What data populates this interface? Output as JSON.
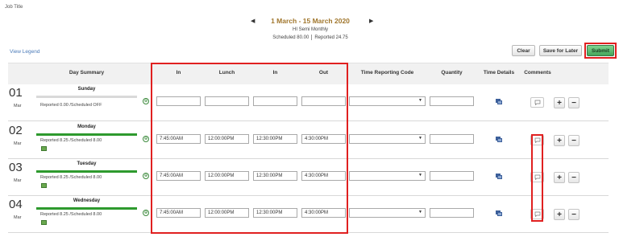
{
  "page": {
    "job_title": "Job Title"
  },
  "period": {
    "prev_arrow": "◀",
    "next_arrow": "▶",
    "range": "1 March - 15 March 2020",
    "type": "HI Semi Monthly",
    "scheduled": "Scheduled  80.00",
    "reported": "Reported  24.75"
  },
  "view_legend": "View Legend",
  "actions": {
    "clear": "Clear",
    "save_for_later": "Save for Later",
    "submit": "Submit"
  },
  "columns": {
    "day_summary": "Day Summary",
    "in": "In",
    "lunch": "Lunch",
    "in2": "In",
    "out": "Out",
    "time_reporting_code": "Time Reporting Code",
    "quantity": "Quantity",
    "time_details": "Time Details",
    "comments": "Comments"
  },
  "icons": {
    "expand": "⊕",
    "dropdown": "▼",
    "plus": "+",
    "minus": "−"
  },
  "colors": {
    "progress": "#2e9a2e",
    "highlight": "#e02020",
    "submit": "#46a45a"
  },
  "rows": [
    {
      "day": "01",
      "month": "Mar",
      "weekday": "Sunday",
      "reported_text": "Reported 0.00 /Scheduled OFF",
      "progress": 0,
      "in": "",
      "lunch": "",
      "in2": "",
      "out": "",
      "trc": "",
      "quantity": ""
    },
    {
      "day": "02",
      "month": "Mar",
      "weekday": "Monday",
      "reported_text": "Reported 8.25 /Scheduled 8.00",
      "progress": 1,
      "in": "7:45:00AM",
      "lunch": "12:00:00PM",
      "in2": "12:30:00PM",
      "out": "4:30:00PM",
      "trc": "",
      "quantity": ""
    },
    {
      "day": "03",
      "month": "Mar",
      "weekday": "Tuesday",
      "reported_text": "Reported 8.25 /Scheduled 8.00",
      "progress": 1,
      "in": "7:45:00AM",
      "lunch": "12:00:00PM",
      "in2": "12:30:00PM",
      "out": "4:30:00PM",
      "trc": "",
      "quantity": ""
    },
    {
      "day": "04",
      "month": "Mar",
      "weekday": "Wednesday",
      "reported_text": "Reported 8.25 /Scheduled 8.00",
      "progress": 1,
      "in": "7:45:00AM",
      "lunch": "12:00:00PM",
      "in2": "12:30:00PM",
      "out": "4:30:00PM",
      "trc": "",
      "quantity": ""
    }
  ]
}
